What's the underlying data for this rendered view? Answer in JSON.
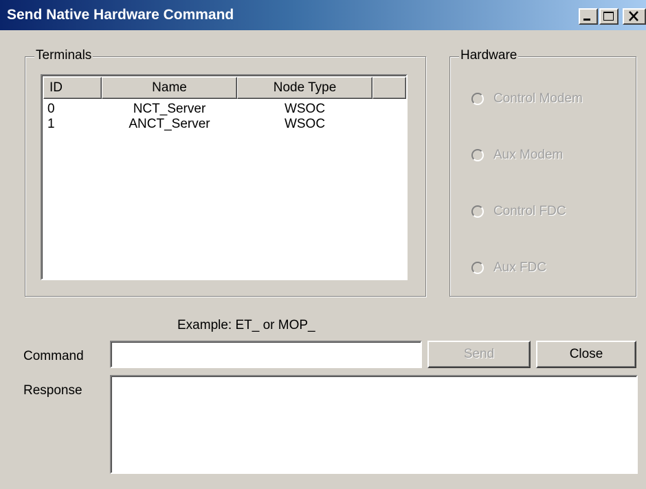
{
  "window": {
    "title": "Send Native Hardware Command"
  },
  "terminals": {
    "group_label": "Terminals",
    "columns": [
      "ID",
      "Name",
      "Node Type"
    ],
    "rows": [
      {
        "id": "0",
        "name": "NCT_Server",
        "node_type": "WSOC"
      },
      {
        "id": "1",
        "name": "ANCT_Server",
        "node_type": "WSOC"
      }
    ]
  },
  "hardware": {
    "group_label": "Hardware",
    "options": [
      {
        "label": "Control Modem",
        "enabled": false,
        "selected": false
      },
      {
        "label": "Aux Modem",
        "enabled": false,
        "selected": false
      },
      {
        "label": "Control FDC",
        "enabled": false,
        "selected": false
      },
      {
        "label": "Aux FDC",
        "enabled": false,
        "selected": false
      }
    ]
  },
  "command": {
    "example_text": "Example: ET_ or MOP_",
    "label": "Command",
    "value": "",
    "send_label": "Send",
    "send_enabled": false,
    "close_label": "Close"
  },
  "response": {
    "label": "Response",
    "value": ""
  },
  "colors": {
    "face": "#d4d0c8",
    "title_start": "#0a246a",
    "title_end": "#a6caf0",
    "disabled_text": "#a0a0a0"
  }
}
